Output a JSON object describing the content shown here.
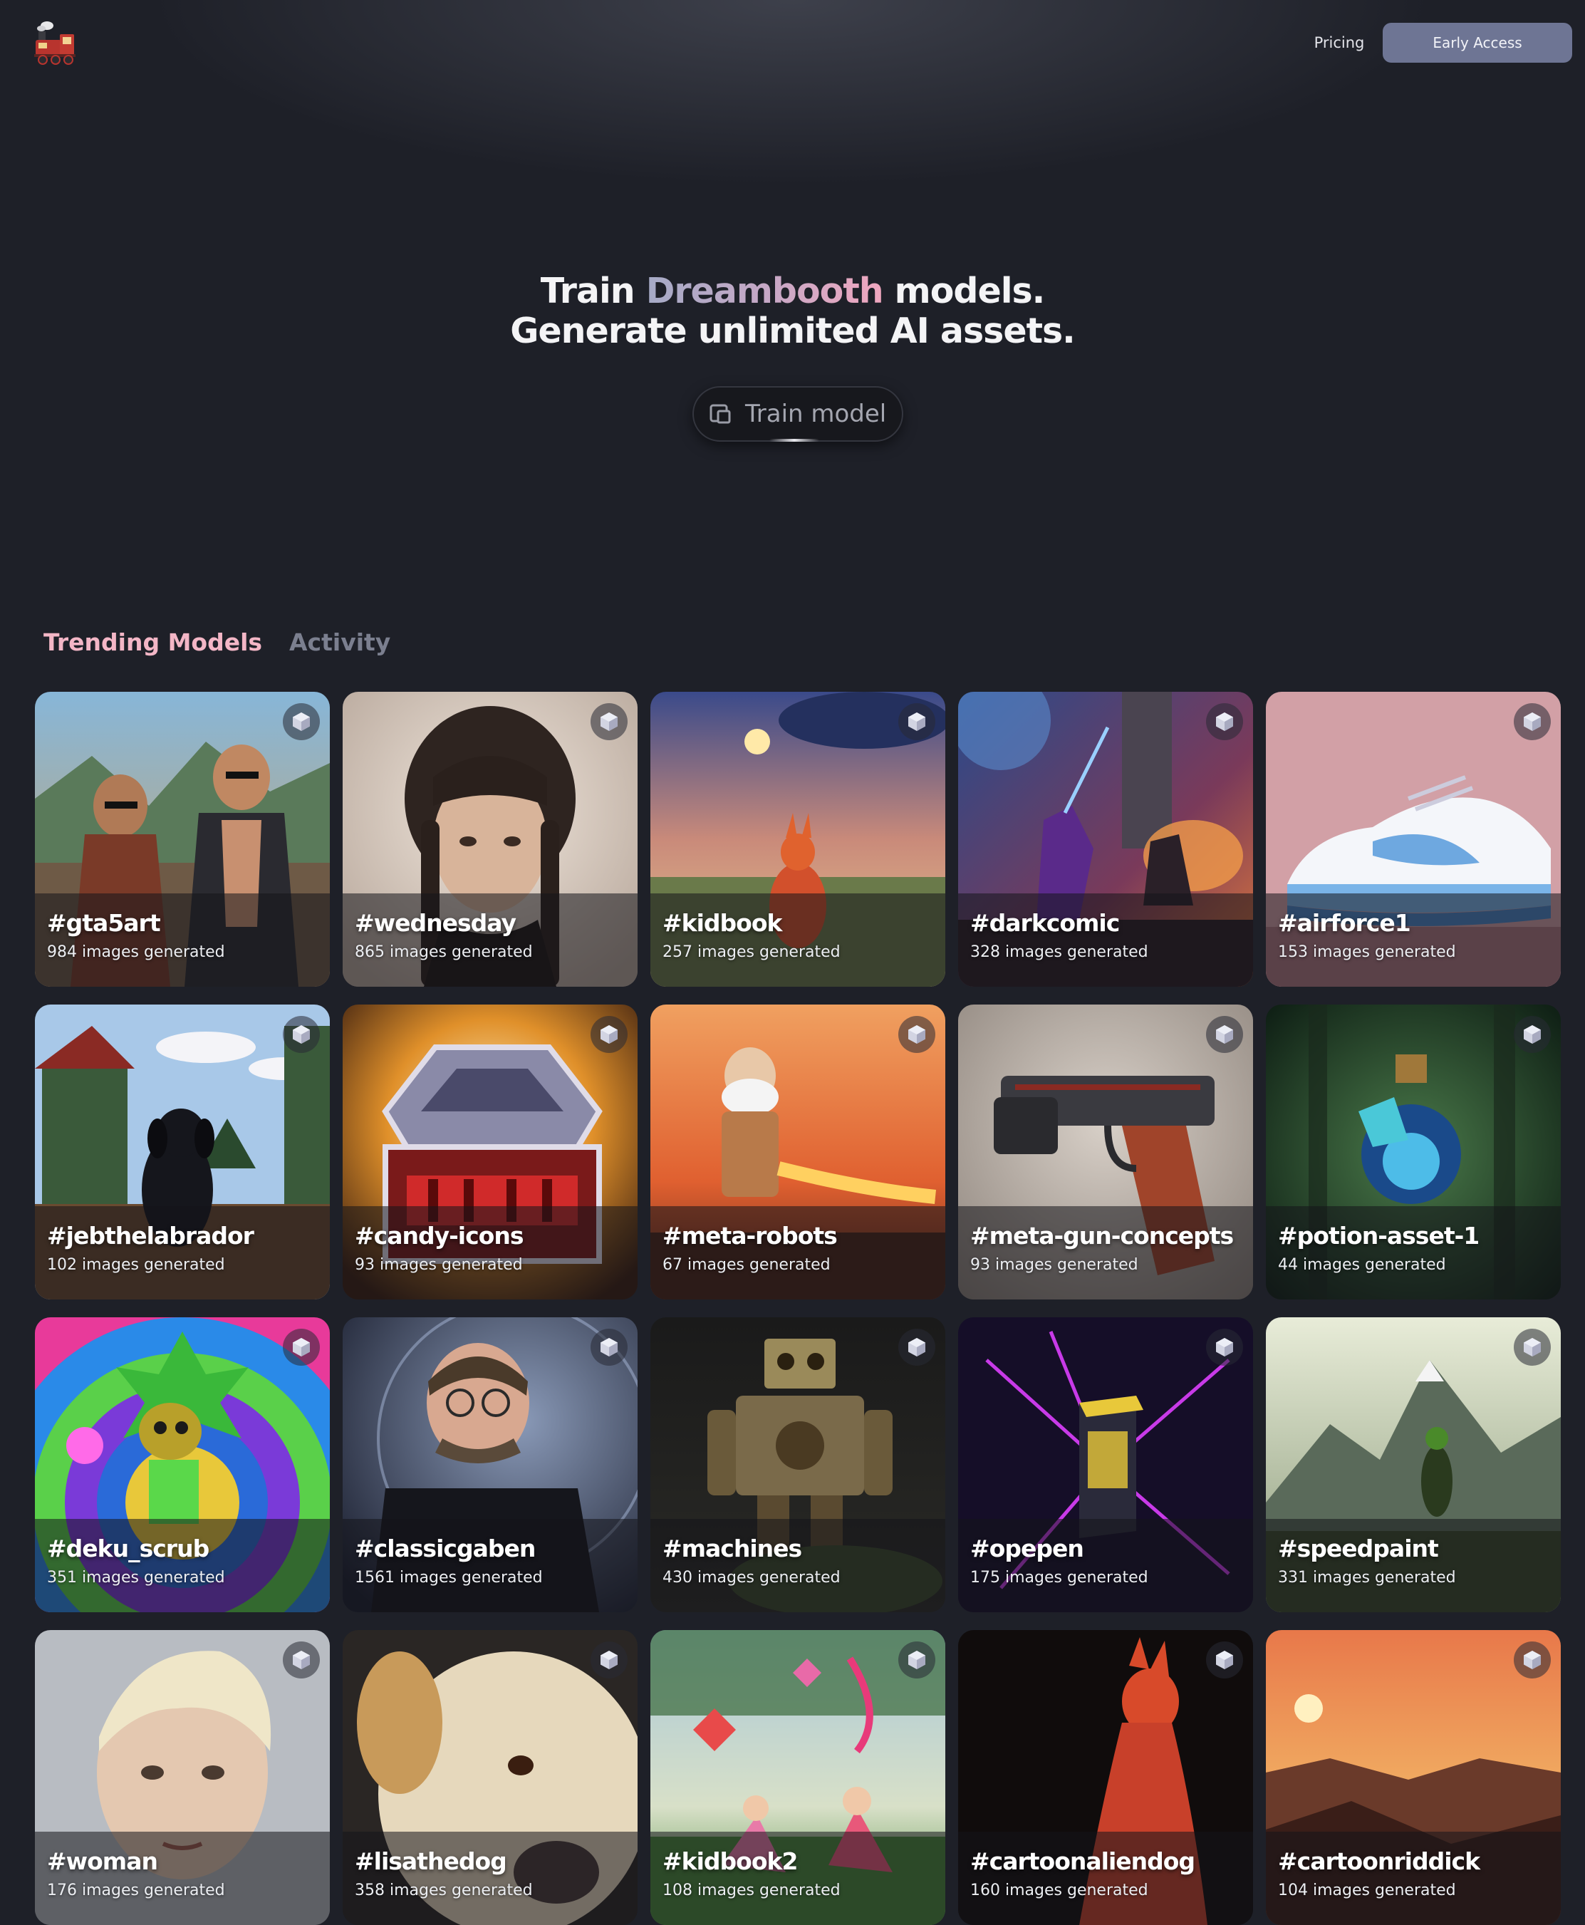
{
  "header": {
    "logo_name": "train-logo",
    "nav": {
      "pricing_label": "Pricing",
      "early_access_label": "Early Access"
    }
  },
  "hero": {
    "line1_pre": "Train ",
    "line1_accent": "Dreambooth",
    "line1_post": " models.",
    "line2": "Generate unlimited AI assets.",
    "button_label": "Train model",
    "button_icon": "train-icon"
  },
  "tabs": [
    {
      "label": "Trending Models",
      "active": true
    },
    {
      "label": "Activity",
      "active": false
    }
  ],
  "colors": {
    "background": "#1e2028",
    "accent_pink": "#f3b6c6",
    "button_early_access": "#6e7594",
    "tab_inactive": "#7b7f8f"
  },
  "badge_icon": "cube-icon",
  "models": [
    {
      "name": "#gta5art",
      "count": "984 images generated",
      "theme": "city-duo"
    },
    {
      "name": "#wednesday",
      "count": "865 images generated",
      "theme": "portrait-girl"
    },
    {
      "name": "#kidbook",
      "count": "257 images generated",
      "theme": "storybook-dusk"
    },
    {
      "name": "#darkcomic",
      "count": "328 images generated",
      "theme": "dark-battle"
    },
    {
      "name": "#airforce1",
      "count": "153 images generated",
      "theme": "sneaker"
    },
    {
      "name": "#jebthelabrador",
      "count": "102 images generated",
      "theme": "farm-dog"
    },
    {
      "name": "#candy-icons",
      "count": "93 images generated",
      "theme": "treasure-chest"
    },
    {
      "name": "#meta-robots",
      "count": "67 images generated",
      "theme": "fiery-robot"
    },
    {
      "name": "#meta-gun-concepts",
      "count": "93 images generated",
      "theme": "pistol"
    },
    {
      "name": "#potion-asset-1",
      "count": "44 images generated",
      "theme": "potion"
    },
    {
      "name": "#deku_scrub",
      "count": "351 images generated",
      "theme": "rainbow-rings"
    },
    {
      "name": "#classicgaben",
      "count": "1561 images generated",
      "theme": "man-portrait"
    },
    {
      "name": "#machines",
      "count": "430 images generated",
      "theme": "steampunk-robot"
    },
    {
      "name": "#opepen",
      "count": "175 images generated",
      "theme": "neon-block"
    },
    {
      "name": "#speedpaint",
      "count": "331 images generated",
      "theme": "mountains"
    },
    {
      "name": "#woman",
      "count": "176 images generated",
      "theme": "blond-portrait"
    },
    {
      "name": "#lisathedog",
      "count": "358 images generated",
      "theme": "dog-closeup"
    },
    {
      "name": "#kidbook2",
      "count": "108 images generated",
      "theme": "kites-meadow"
    },
    {
      "name": "#cartoonaliendog",
      "count": "160 images generated",
      "theme": "red-dog-dark"
    },
    {
      "name": "#cartoonriddick",
      "count": "104 images generated",
      "theme": "sunset-coast"
    }
  ]
}
